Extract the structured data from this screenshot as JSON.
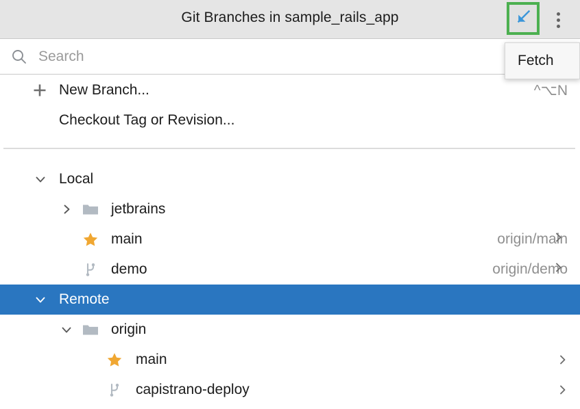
{
  "window": {
    "title": "Git Branches in sample_rails_app"
  },
  "titlebar": {
    "fetch_button": {
      "name": "Fetch",
      "icon": "fetch-arrow-icon",
      "highlight_color": "#4cb050",
      "arrow_color": "#3b96d9"
    },
    "more_button": {
      "name": "More",
      "icon": "more-vertical-icon"
    }
  },
  "tooltip": {
    "text": "Fetch",
    "visible": true
  },
  "search": {
    "placeholder": "Search",
    "value": "",
    "icon": "search-icon"
  },
  "actions": [
    {
      "label": "New Branch...",
      "icon": "plus-icon",
      "shortcut": "^⌥N"
    },
    {
      "label": "Checkout Tag or Revision...",
      "icon": "",
      "shortcut": ""
    }
  ],
  "tree": [
    {
      "label": "Local",
      "level": 0,
      "expander": "chevron-down-icon",
      "icon": "",
      "tracking": "",
      "chevron": false,
      "selected": false
    },
    {
      "label": "jetbrains",
      "level": 1,
      "expander": "chevron-right-icon",
      "icon": "folder-icon",
      "tracking": "",
      "chevron": false,
      "selected": false
    },
    {
      "label": "main",
      "level": 1,
      "expander": "",
      "icon": "star-icon",
      "tracking": "origin/main",
      "chevron": true,
      "selected": false
    },
    {
      "label": "demo",
      "level": 1,
      "expander": "",
      "icon": "branch-icon",
      "tracking": "origin/demo",
      "chevron": true,
      "selected": false
    },
    {
      "label": "Remote",
      "level": 0,
      "expander": "chevron-down-icon",
      "icon": "",
      "tracking": "",
      "chevron": false,
      "selected": true
    },
    {
      "label": "origin",
      "level": 1,
      "expander": "chevron-down-icon",
      "icon": "folder-icon",
      "tracking": "",
      "chevron": false,
      "selected": false
    },
    {
      "label": "main",
      "level": 2,
      "expander": "",
      "icon": "star-icon",
      "tracking": "",
      "chevron": true,
      "selected": false
    },
    {
      "label": "capistrano-deploy",
      "level": 2,
      "expander": "",
      "icon": "branch-icon",
      "tracking": "",
      "chevron": true,
      "selected": false
    }
  ],
  "colors": {
    "selection_blue": "#2a76c0",
    "star_amber": "#f0a732",
    "titlebar_gray": "#e5e5e5",
    "muted_text": "#8f8f8f"
  }
}
